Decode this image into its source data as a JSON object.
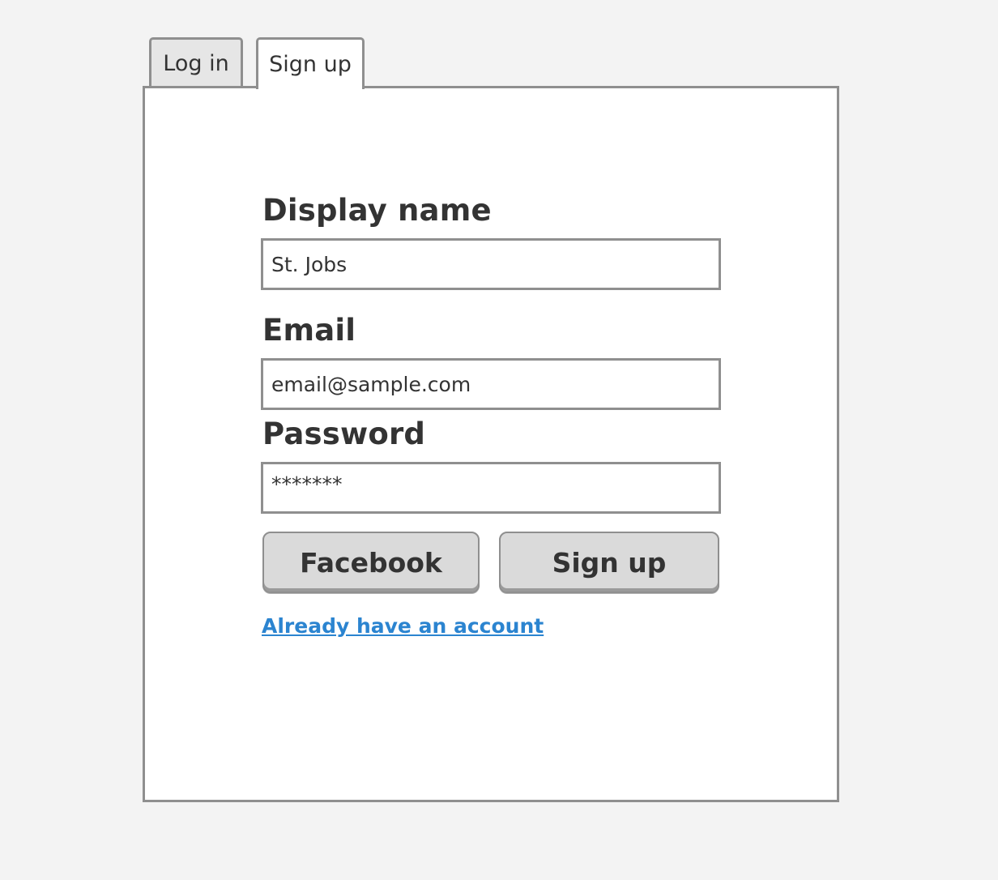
{
  "tabs": [
    {
      "label": "Log in",
      "active": false
    },
    {
      "label": "Sign up",
      "active": true
    }
  ],
  "form": {
    "display_name": {
      "label": "Display name",
      "value": "St. Jobs"
    },
    "email": {
      "label": "Email",
      "value": "email@sample.com"
    },
    "password": {
      "label": "Password",
      "value": "*******"
    }
  },
  "buttons": {
    "facebook_label": "Facebook",
    "signup_label": "Sign up"
  },
  "link": {
    "label": "Already have an account"
  },
  "colors": {
    "background": "#f3f3f3",
    "panel": "#ffffff",
    "border": "#8f8f8f",
    "button": "#dadada",
    "link": "#2b84d0",
    "text": "#333333"
  }
}
